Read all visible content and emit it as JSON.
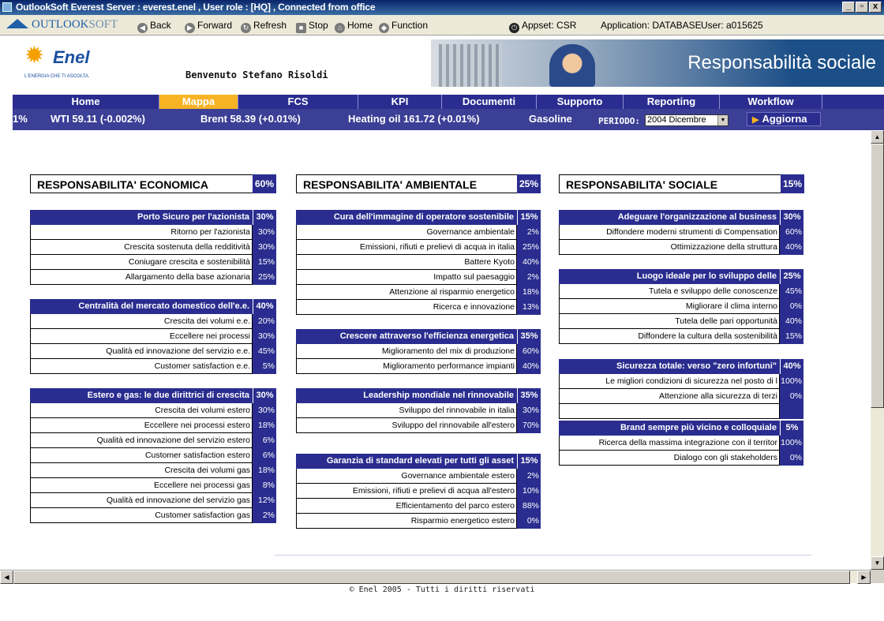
{
  "window": {
    "title": "OutlookSoft Everest   Server : everest.enel , User role : [HQ] , Connected from office",
    "minimize_glyph": "_",
    "restore_glyph": "▫",
    "close_glyph": "x"
  },
  "toolbar": {
    "brand_main": "OUTLOOK",
    "brand_soft": "SOFT",
    "back": "Back",
    "forward": "Forward",
    "refresh": "Refresh",
    "stop": "Stop",
    "home": "Home",
    "function": "Function",
    "appset": "Appset: CSR",
    "application": "Application: DATABASE",
    "user": "User: a015625"
  },
  "header": {
    "logo_name": "Enel",
    "logo_tagline": "L'ENERGIA CHE TI ASCOLTA.",
    "welcome": "Benvenuto Stefano Risoldi",
    "banner_title": "Responsabilità sociale"
  },
  "nav": {
    "items": [
      {
        "label": "Home"
      },
      {
        "label": "Mappa"
      },
      {
        "label": "FCS"
      },
      {
        "label": "KPI"
      },
      {
        "label": "Documenti"
      },
      {
        "label": "Supporto"
      },
      {
        "label": "Reporting"
      },
      {
        "label": "Workflow"
      }
    ],
    "active": "Mappa"
  },
  "ticker": {
    "items": [
      "1%",
      "WTI 59.11 (-0.002%)",
      "Brent 58.39 (+0.01%)",
      "Heating oil 161.72 (+0.01%)",
      "Gasoline"
    ],
    "periodo_label": "PERIODO:",
    "periodo_value": "2004 Dicembre",
    "aggiorna": "Aggiorna"
  },
  "columns": [
    {
      "title": "RESPONSABILITA' ECONOMICA",
      "percent": "60%",
      "groups": [
        {
          "title": "Porto Sicuro per l'azionista",
          "percent": "30%",
          "items": [
            {
              "label": "Ritorno per l'azionista",
              "percent": "30%"
            },
            {
              "label": "Crescita sostenuta della redditività",
              "percent": "30%"
            },
            {
              "label": "Coniugare crescita e sostenibilità",
              "percent": "15%"
            },
            {
              "label": "Allargamento della base azionaria",
              "percent": "25%"
            }
          ]
        },
        {
          "title": "Centralità del mercato domestico dell'e.e.",
          "percent": "40%",
          "items": [
            {
              "label": "Crescita dei volumi e.e.",
              "percent": "20%"
            },
            {
              "label": "Eccellere nei processi",
              "percent": "30%"
            },
            {
              "label": "Qualità ed innovazione del servizio e.e.",
              "percent": "45%"
            },
            {
              "label": "Customer satisfaction e.e.",
              "percent": "5%"
            }
          ]
        },
        {
          "title": "Estero e gas: le due dirittrici di crescita",
          "percent": "30%",
          "items": [
            {
              "label": "Crescita dei volumi estero",
              "percent": "30%"
            },
            {
              "label": "Eccellere nei processi estero",
              "percent": "18%"
            },
            {
              "label": "Qualità ed innovazione del servizio estero",
              "percent": "6%"
            },
            {
              "label": "Customer satisfaction estero",
              "percent": "6%"
            },
            {
              "label": "Crescita dei volumi gas",
              "percent": "18%"
            },
            {
              "label": "Eccellere nei processi gas",
              "percent": "8%"
            },
            {
              "label": "Qualità ed innovazione del servizio gas",
              "percent": "12%"
            },
            {
              "label": "Customer satisfaction gas",
              "percent": "2%"
            }
          ]
        }
      ]
    },
    {
      "title": "RESPONSABILITA' AMBIENTALE",
      "percent": "25%",
      "groups": [
        {
          "title": "Cura dell'immagine di operatore sostenibile",
          "percent": "15%",
          "items": [
            {
              "label": "Governance ambientale",
              "percent": "2%"
            },
            {
              "label": "Emissioni, rifiuti e prelievi di acqua in italia",
              "percent": "25%"
            },
            {
              "label": "Battere Kyoto",
              "percent": "40%"
            },
            {
              "label": "Impatto sul paesaggio",
              "percent": "2%"
            },
            {
              "label": "Attenzione al risparmio energetico",
              "percent": "18%"
            },
            {
              "label": "Ricerca e innovazione",
              "percent": "13%"
            }
          ]
        },
        {
          "title": "Crescere attraverso l'efficienza energetica",
          "percent": "35%",
          "items": [
            {
              "label": "Miglioramento del mix di produzione",
              "percent": "60%"
            },
            {
              "label": "Miglioramento performance impianti",
              "percent": "40%"
            }
          ]
        },
        {
          "title": "Leadership mondiale nel rinnovabile",
          "percent": "35%",
          "items": [
            {
              "label": "Sviluppo del rinnovabile in italia",
              "percent": "30%"
            },
            {
              "label": "Sviluppo del rinnovabile all'estero",
              "percent": "70%"
            }
          ]
        },
        {
          "title": "Garanzia di standard elevati  per tutti gli asset",
          "percent": "15%",
          "items": [
            {
              "label": "Governance ambientale estero",
              "percent": "2%"
            },
            {
              "label": "Emissioni, rifiuti e prelievi di acqua all'estero",
              "percent": "10%"
            },
            {
              "label": "Efficientamento del parco estero",
              "percent": "88%"
            },
            {
              "label": "Risparmio energetico estero",
              "percent": "0%"
            }
          ]
        }
      ]
    },
    {
      "title": "RESPONSABILITA' SOCIALE",
      "percent": "15%",
      "groups": [
        {
          "title": "Adeguare l'organizzazione al business",
          "percent": "30%",
          "items": [
            {
              "label": "Diffondere moderni strumenti di Compensation",
              "percent": "60%"
            },
            {
              "label": "Ottimizzazione della struttura",
              "percent": "40%"
            }
          ]
        },
        {
          "title": "Luogo ideale per lo sviluppo delle",
          "percent": "25%",
          "items": [
            {
              "label": "Tutela e sviluppo delle conoscenze",
              "percent": "45%"
            },
            {
              "label": "Migliorare il clima interno",
              "percent": "0%"
            },
            {
              "label": "Tutela delle pari opportunità",
              "percent": "40%"
            },
            {
              "label": "Diffondere la cultura della sostenibilità",
              "percent": "15%"
            }
          ]
        },
        {
          "title": "Sicurezza totale: verso \"zero infortuni\"",
          "percent": "40%",
          "items": [
            {
              "label": "Le migliori condizioni di sicurezza nel posto di l",
              "percent": "100%"
            },
            {
              "label": "Attenzione alla sicurezza di terzi",
              "percent": "0%"
            },
            {
              "label": "",
              "percent": ""
            }
          ]
        },
        {
          "title": "Brand sempre più vicino e colloquiale",
          "percent": "5%",
          "items": [
            {
              "label": "Ricerca della massima integrazione con il territor",
              "percent": "100%"
            },
            {
              "label": "Dialogo con gli stakeholders",
              "percent": "0%"
            }
          ]
        }
      ]
    }
  ],
  "footer": "© Enel 2005 - Tutti i diritti riservati"
}
